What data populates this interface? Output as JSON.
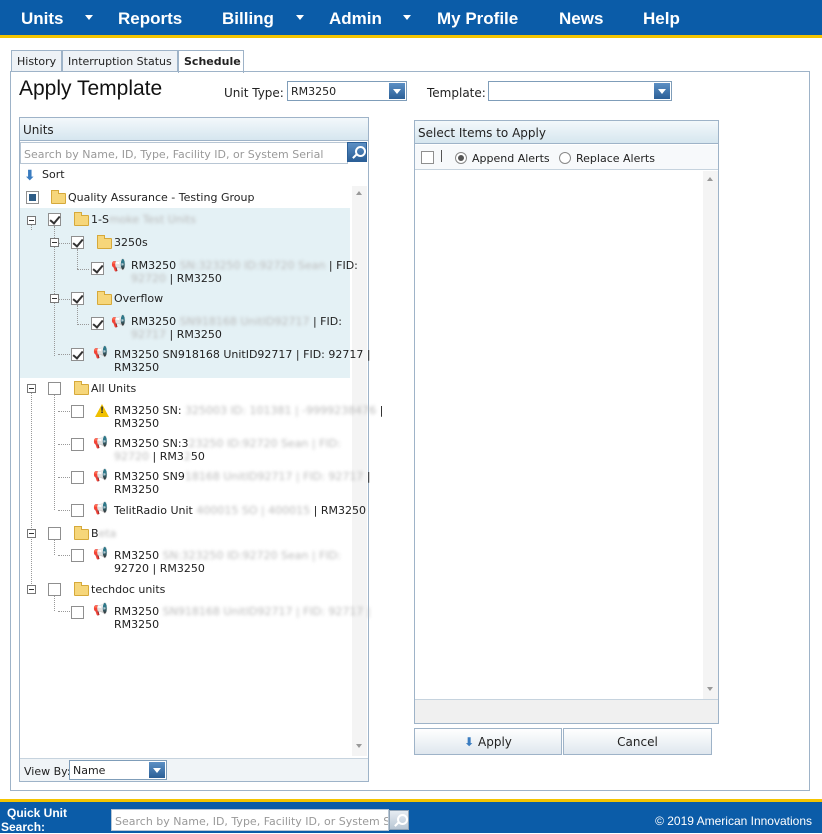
{
  "nav": {
    "units": "Units",
    "reports": "Reports",
    "billing": "Billing",
    "admin": "Admin",
    "my_profile": "My Profile",
    "news": "News",
    "help": "Help"
  },
  "tabs": {
    "history": "History",
    "interruption_status": "Interruption Status",
    "schedule": "Schedule"
  },
  "page_title": "Apply Template",
  "unit_type": {
    "label": "Unit Type:",
    "value": "RM3250"
  },
  "template": {
    "label": "Template:",
    "value": ""
  },
  "units_panel": {
    "title": "Units",
    "search_placeholder": "Search by Name, ID, Type, Facility ID, or System Serial",
    "sort_label": "Sort",
    "view_by_label": "View By:",
    "view_by_value": "Name"
  },
  "tree": {
    "qa_group": "Quality Assurance - Testing Group",
    "smoke_group": "1-S",
    "smoke_blur": "moke Test Units",
    "folder_3250s": "3250s",
    "u1_a": "RM3250",
    "u1_blur": "SN:323250 ID:92720 Sean",
    "u1_b": "| FID:",
    "u1_c_blur": "92720",
    "u1_d": "| RM3250",
    "folder_overflow": "Overflow",
    "u2_a": "RM3250",
    "u2_blur": "SN918168 UnitID92717",
    "u2_b": "| FID:",
    "u2_c_blur": "92717",
    "u2_d": "| RM3250",
    "u3_line1": "RM3250 SN918168 UnitID92717 | FID: 92717 |",
    "u3_line2": "RM3250",
    "all_units": "All Units",
    "a1_a": "RM3250 SN:",
    "a1_blur": "325003 ID: 101381 | -9999238476",
    "a1_b": "|",
    "a1_c": "RM3250",
    "a2_a": "RM3250 SN:3",
    "a2_blur": "23250 ID:92720 Sean | FID:",
    "a2_c_blur": "92720",
    "a2_d": "| RM3",
    "a2_e_blur": "2",
    "a2_f": "50",
    "a3_a": "RM3250 SN9",
    "a3_blur": "18168 UnitID92717 | FID: 92717",
    "a3_b": "|",
    "a3_c": "RM3250",
    "a4_a": "TelitRadio Unit",
    "a4_blur": "400015 SO | 400015",
    "a4_b": "| RM3250",
    "group_b": "B",
    "group_b_blur": "eta",
    "b1_a": "RM3250",
    "b1_blur": "SN:323250 ID:92720 Sean | FID:",
    "b1_c": "92720 | RM3250",
    "techdoc": "techdoc units",
    "t1_a": "RM3250",
    "t1_blur": "SN918168 UnitID92717 | FID: 92717 |",
    "t1_c": "RM3250"
  },
  "items_panel": {
    "title": "Select Items to Apply",
    "append": "Append Alerts",
    "replace": "Replace Alerts"
  },
  "buttons": {
    "apply": "Apply",
    "cancel": "Cancel"
  },
  "footer": {
    "quick_search_label_1": "Quick Unit",
    "quick_search_label_2": "Search:",
    "quick_search_placeholder": "Search by Name, ID, Type, Facility ID, or System Serial",
    "copyright": "© 2019 American Innovations"
  },
  "colors": {
    "brand_blue": "#0b5ca8",
    "accent_yellow": "#f4c400",
    "highlight": "#e4f1f5"
  }
}
